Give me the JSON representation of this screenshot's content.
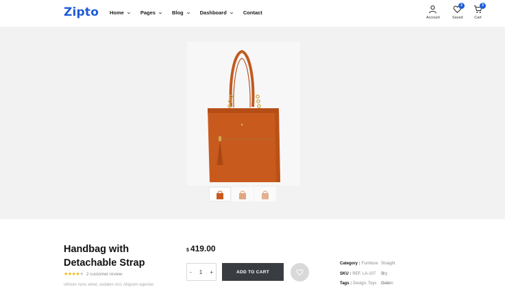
{
  "header": {
    "logo": "Zipto",
    "nav": [
      {
        "label": "Home",
        "dropdown": true
      },
      {
        "label": "Pages",
        "dropdown": true
      },
      {
        "label": "Blog",
        "dropdown": true
      },
      {
        "label": "Dashboard",
        "dropdown": true
      },
      {
        "label": "Contact",
        "dropdown": false
      }
    ],
    "account_label": "Account",
    "saved_label": "Saved",
    "saved_count": "2",
    "cart_label": "Cart",
    "cart_count": "3"
  },
  "gallery": {
    "main_icon": "handbag-image",
    "thumbnails": [
      "handbag-front-thumb",
      "handbag-side-thumb",
      "handbag-back-thumb"
    ],
    "bag_color": "#c85a1e"
  },
  "product": {
    "title": "Handbag with Detachable Strap",
    "rating": 4,
    "rating_max": 5,
    "stars_filled": "★★★★",
    "stars_empty": "★",
    "review_text": "2 customer review",
    "description": "ultrices nunc amet, sodales orci. Aliquam egestas",
    "currency": "$",
    "price": "419.00",
    "qty_minus": "-",
    "qty_value": "1",
    "qty_plus": "+",
    "add_to_cart": "ADD TO CART"
  },
  "meta": {
    "category_key": "Category :",
    "category_val": "Furniture",
    "category_extra": "Straight fit",
    "sku_key": "SKU :",
    "sku_val": "REF. LA-107",
    "sku_extra": "Dry clean",
    "tags_key": "Tags :",
    "tags_val": "Design, Toys",
    "tags_extra": "Cotton shirt"
  },
  "colors": {
    "brand": "#1e5bd8",
    "button_dark": "#393c40",
    "gallery_bg": "#f2f2f2"
  }
}
